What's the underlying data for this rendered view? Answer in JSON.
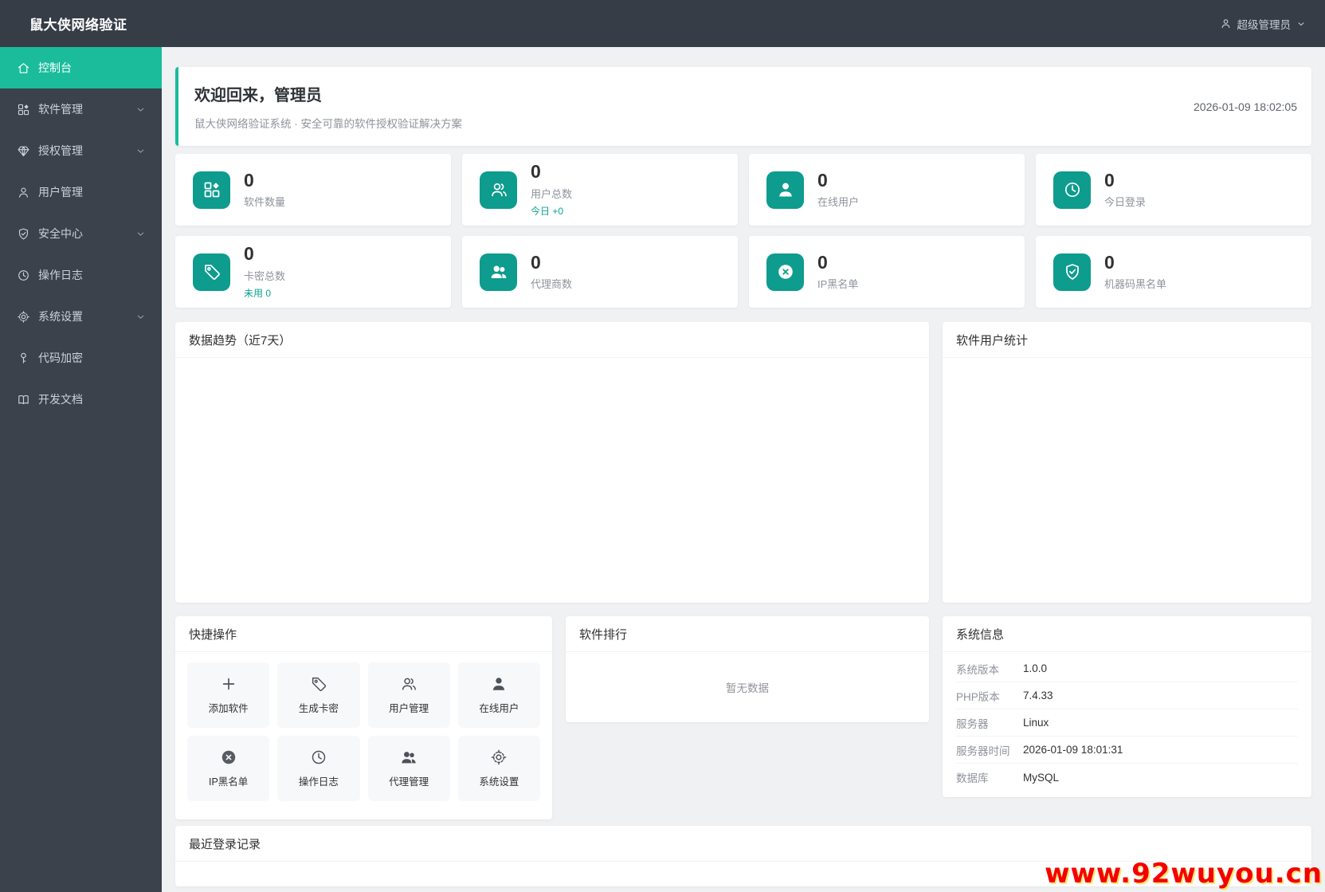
{
  "topbar": {
    "brand": "鼠大侠网络验证",
    "user": "超级管理员",
    "user_icon": "person-icon",
    "dropdown_icon": "chevron-down-icon"
  },
  "sidebar": {
    "items": [
      {
        "label": "控制台",
        "icon": "home-icon",
        "active": true,
        "expandable": false
      },
      {
        "label": "软件管理",
        "icon": "grid-icon",
        "active": false,
        "expandable": true
      },
      {
        "label": "授权管理",
        "icon": "gem-icon",
        "active": false,
        "expandable": true
      },
      {
        "label": "用户管理",
        "icon": "user-icon",
        "active": false,
        "expandable": false
      },
      {
        "label": "安全中心",
        "icon": "shield-check-icon",
        "active": false,
        "expandable": true
      },
      {
        "label": "操作日志",
        "icon": "clock-icon",
        "active": false,
        "expandable": false
      },
      {
        "label": "系统设置",
        "icon": "gear-icon",
        "active": false,
        "expandable": true
      },
      {
        "label": "代码加密",
        "icon": "key-icon",
        "active": false,
        "expandable": false
      },
      {
        "label": "开发文档",
        "icon": "book-icon",
        "active": false,
        "expandable": false
      }
    ]
  },
  "welcome": {
    "title": "欢迎回来，管理员",
    "subtitle": "鼠大侠网络验证系统 · 安全可靠的软件授权验证解决方案",
    "timestamp": "2026-01-09 18:02:05"
  },
  "stats": [
    {
      "value": "0",
      "label": "软件数量",
      "icon": "grid-icon"
    },
    {
      "value": "0",
      "label": "用户总数",
      "sub": "今日 +0",
      "icon": "users-icon"
    },
    {
      "value": "0",
      "label": "在线用户",
      "icon": "user-filled-icon"
    },
    {
      "value": "0",
      "label": "今日登录",
      "icon": "clock-icon"
    },
    {
      "value": "0",
      "label": "卡密总数",
      "sub": "未用 0",
      "icon": "tag-icon"
    },
    {
      "value": "0",
      "label": "代理商数",
      "icon": "users-filled-icon"
    },
    {
      "value": "0",
      "label": "IP黑名单",
      "icon": "circle-x-icon"
    },
    {
      "value": "0",
      "label": "机器码黑名单",
      "icon": "shield-check-icon"
    }
  ],
  "panels": {
    "trend": {
      "title": "数据趋势（近7天）"
    },
    "software_users": {
      "title": "软件用户统计"
    },
    "quick": {
      "title": "快捷操作",
      "actions": [
        {
          "label": "添加软件",
          "icon": "plus-icon"
        },
        {
          "label": "生成卡密",
          "icon": "tag-icon"
        },
        {
          "label": "用户管理",
          "icon": "users-icon"
        },
        {
          "label": "在线用户",
          "icon": "user-filled-icon"
        },
        {
          "label": "IP黑名单",
          "icon": "circle-x-icon"
        },
        {
          "label": "操作日志",
          "icon": "clock-icon"
        },
        {
          "label": "代理管理",
          "icon": "users-filled-icon"
        },
        {
          "label": "系统设置",
          "icon": "gear-icon"
        }
      ]
    },
    "ranking": {
      "title": "软件排行",
      "empty": "暂无数据"
    },
    "system": {
      "title": "系统信息",
      "rows": [
        {
          "label": "系统版本",
          "value": "1.0.0"
        },
        {
          "label": "PHP版本",
          "value": "7.4.33"
        },
        {
          "label": "服务器",
          "value": "Linux"
        },
        {
          "label": "服务器时间",
          "value": "2026-01-09 18:01:31"
        },
        {
          "label": "数据库",
          "value": "MySQL"
        }
      ]
    },
    "recent": {
      "title": "最近登录记录"
    }
  },
  "watermark": {
    "text": "www.92wuyou.cn",
    "color": "#f50000"
  },
  "colors": {
    "accent": "#1abc9c",
    "icon_tile": "#0d9c8e",
    "topbar": "#363d47",
    "sidebar": "#3b424c",
    "background": "#f0f1f2"
  }
}
